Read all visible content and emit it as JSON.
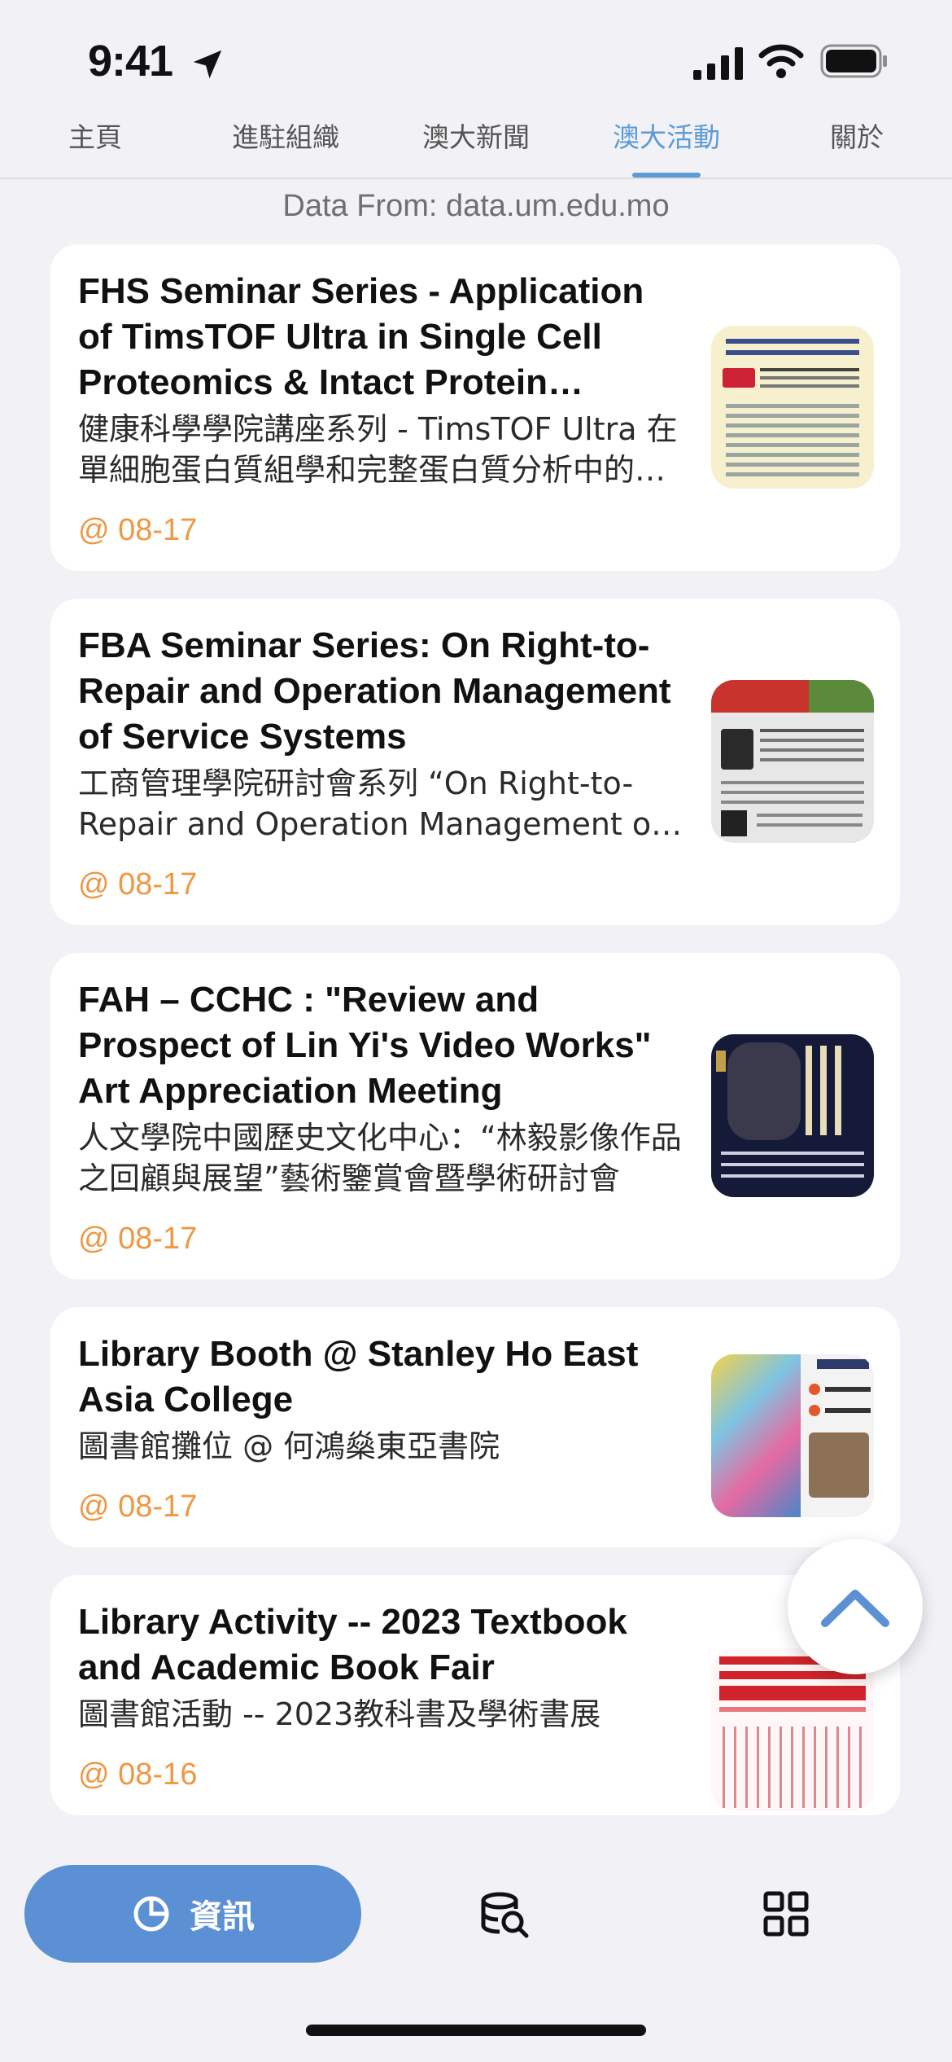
{
  "status_bar": {
    "time": "9:41"
  },
  "top_tabs": [
    {
      "label": "主頁",
      "active": false
    },
    {
      "label": "進駐組織",
      "active": false
    },
    {
      "label": "澳大新聞",
      "active": false
    },
    {
      "label": "澳大活動",
      "active": true
    },
    {
      "label": "關於",
      "active": false
    }
  ],
  "source_note": "Data From: data.um.edu.mo",
  "events": [
    {
      "title": "FHS Seminar Series - Application of TimsTOF Ultra in Single Cell Proteomics & Intact Protein Analysis",
      "subtitle": "健康科學學院講座系列 - TimsTOF Ultra 在單細胞蛋白質組學和完整蛋白質分析中的應用",
      "date": "@ 08-17"
    },
    {
      "title": "FBA Seminar Series: On Right-to-Repair and Operation Management of Service Systems",
      "subtitle": "工商管理學院研討會系列 “On Right-to-Repair and Operation Management of Service Systems”",
      "date": "@ 08-17"
    },
    {
      "title": "FAH – CCHC : \"Review and Prospect of Lin Yi's Video Works\" Art Appreciation Meeting",
      "subtitle": "人文學院中國歷史文化中心：“林毅影像作品之回顧與展望”藝術鑒賞會暨學術研討會",
      "date": "@ 08-17"
    },
    {
      "title": "Library Booth @ Stanley Ho East Asia College",
      "subtitle": "圖書館攤位 @ 何鴻燊東亞書院",
      "date": "@ 08-17"
    },
    {
      "title": "Library Activity -- 2023 Textbook and Academic Book Fair",
      "subtitle": "圖書館活動 -- 2023教科書及學術書展",
      "date": "@ 08-16"
    }
  ],
  "bottom_tabs": {
    "active_label": "資訊"
  },
  "colors": {
    "accent": "#5b9bd8",
    "date": "#ef9742",
    "background": "#f2f2f6"
  }
}
